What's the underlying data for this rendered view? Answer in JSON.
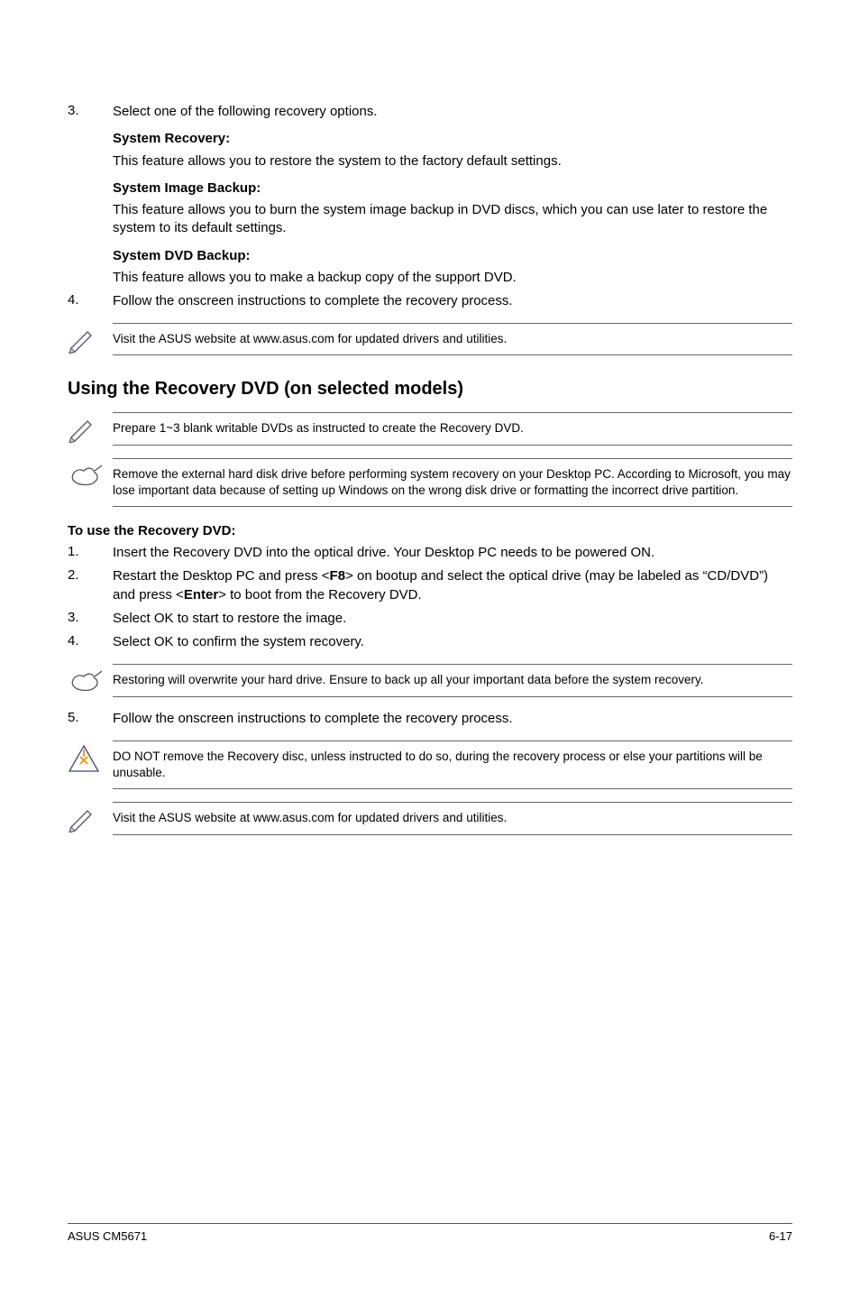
{
  "steps_top": [
    {
      "num": "3.",
      "text": "Select one of the following recovery options."
    },
    {
      "num": "4.",
      "text": "Follow the onscreen instructions to complete the recovery process."
    }
  ],
  "recovery_options": [
    {
      "title": "System Recovery:",
      "desc": "This feature allows you to restore the system to the factory default settings."
    },
    {
      "title": "System Image Backup:",
      "desc": "This feature allows you to burn the system image backup in DVD discs, which you can use later to restore the system to its default settings."
    },
    {
      "title": "System DVD Backup:",
      "desc": "This feature allows you to make a backup copy of the support DVD."
    }
  ],
  "notes": {
    "visit_asus": "Visit the ASUS website at www.asus.com for updated drivers and utilities.",
    "prepare_dvds": "Prepare 1~3 blank writable DVDs as instructed to create the Recovery DVD.",
    "remove_drive": "Remove the external hard disk drive before performing system recovery on your Desktop PC. According to Microsoft, you may lose important data because of setting up Windows on the wrong disk drive or formatting the incorrect drive partition.",
    "restoring_warn": "Restoring will overwrite your hard drive. Ensure to back up all your important data before the system recovery.",
    "do_not_remove": "DO NOT remove the Recovery disc, unless instructed to do so, during the recovery process or else your partitions will be unusable."
  },
  "section_heading": "Using the Recovery DVD (on selected models)",
  "subheading": "To use the Recovery DVD:",
  "steps_dvd_part1": [
    {
      "num": "1.",
      "text": "Insert the Recovery DVD into the optical drive. Your Desktop PC needs to be powered ON."
    }
  ],
  "step_dvd_2": {
    "num": "2.",
    "pre": "Restart the Desktop PC and press <",
    "key1": "F8",
    "mid": "> on bootup and select the optical drive (may be labeled as “CD/DVD”) and press <",
    "key2": "Enter",
    "post": "> to boot from the Recovery DVD."
  },
  "steps_dvd_rest": [
    {
      "num": "3.",
      "text": "Select OK to start to restore the image."
    },
    {
      "num": "4.",
      "text": "Select OK to confirm the system recovery."
    },
    {
      "num": "5.",
      "text": "Follow the onscreen instructions to complete the recovery process."
    }
  ],
  "footer": {
    "left": "ASUS CM5671",
    "right": "6-17"
  }
}
